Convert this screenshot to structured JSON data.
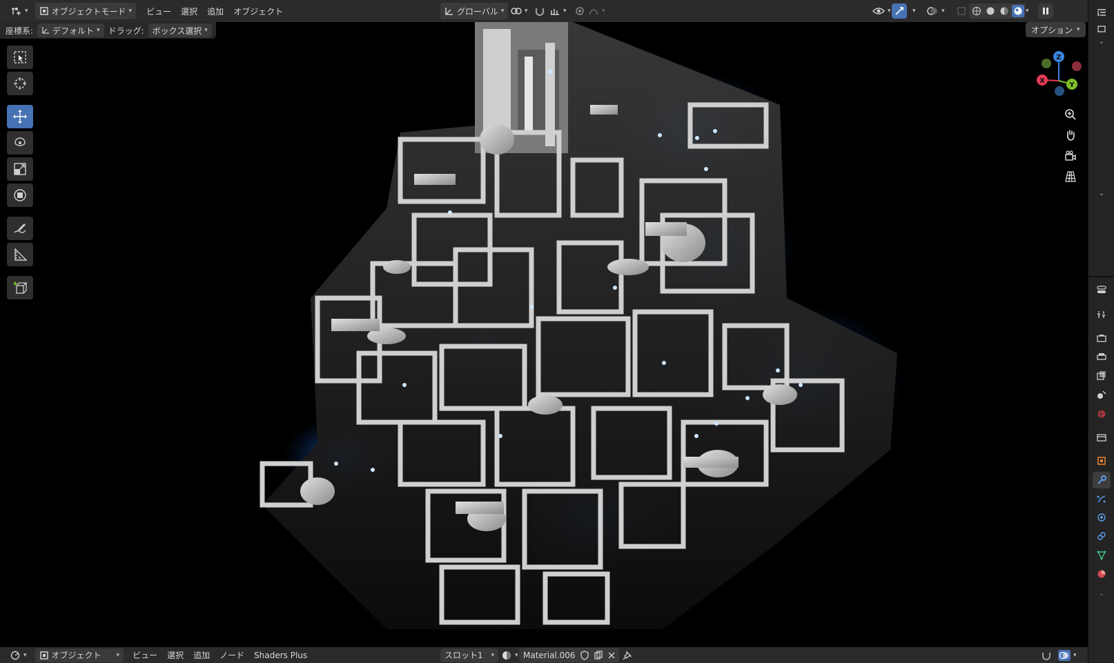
{
  "header": {
    "editor_type_icon": "editor-type-icon",
    "mode_label": "オブジェクトモード",
    "menus": [
      "ビュー",
      "選択",
      "追加",
      "オブジェクト"
    ],
    "transform_orientation": "グローバル"
  },
  "tool_settings": {
    "orientation_label": "座標系:",
    "orientation_value": "デフォルト",
    "drag_label": "ドラッグ:",
    "drag_value": "ボックス選択",
    "options_label": "オプション"
  },
  "toolbar": {
    "tools": [
      {
        "name": "select-box-tool",
        "icon": "select-box-icon",
        "active": false
      },
      {
        "name": "cursor-tool",
        "icon": "cursor-icon",
        "active": false
      },
      {
        "name": "move-tool",
        "icon": "move-icon",
        "active": true
      },
      {
        "name": "rotate-tool",
        "icon": "rotate-icon",
        "active": false
      },
      {
        "name": "scale-tool",
        "icon": "scale-icon",
        "active": false
      },
      {
        "name": "transform-tool",
        "icon": "transform-icon",
        "active": false
      },
      {
        "name": "annotate-tool",
        "icon": "annotate-icon",
        "active": false
      },
      {
        "name": "measure-tool",
        "icon": "measure-icon",
        "active": false
      },
      {
        "name": "add-cube-tool",
        "icon": "add-cube-icon",
        "active": false
      }
    ]
  },
  "gizmo": {
    "axes": [
      "Z",
      "X",
      "Y"
    ],
    "colors": {
      "x": "#e43b54",
      "y": "#7fbf2a",
      "z": "#3a84e0"
    }
  },
  "nav_buttons": [
    "zoom-icon",
    "pan-hand-icon",
    "camera-view-icon",
    "perspective-grid-icon"
  ],
  "bottombar": {
    "editor_type_icon": "shader-editor-icon",
    "mode_label": "オブジェクト",
    "menus": [
      "ビュー",
      "選択",
      "追加",
      "ノード",
      "Shaders Plus"
    ],
    "slot_label": "スロット1",
    "material_name": "Material.006"
  },
  "colors": {
    "accent": "#4772b3",
    "glow_blue": "#1e6fd9",
    "panel": "#2b2b2b"
  }
}
